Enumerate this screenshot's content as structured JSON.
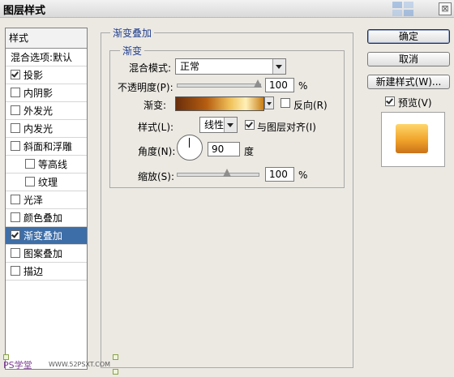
{
  "window": {
    "title": "图层样式",
    "close_label": "⊠"
  },
  "left_panel": {
    "header": "样式",
    "items": [
      {
        "label": "混合选项:默认",
        "checkbox": false,
        "checked": false,
        "selected": false,
        "sub": false
      },
      {
        "label": "投影",
        "checkbox": true,
        "checked": true,
        "selected": false,
        "sub": false
      },
      {
        "label": "内阴影",
        "checkbox": true,
        "checked": false,
        "selected": false,
        "sub": false
      },
      {
        "label": "外发光",
        "checkbox": true,
        "checked": false,
        "selected": false,
        "sub": false
      },
      {
        "label": "内发光",
        "checkbox": true,
        "checked": false,
        "selected": false,
        "sub": false
      },
      {
        "label": "斜面和浮雕",
        "checkbox": true,
        "checked": false,
        "selected": false,
        "sub": false
      },
      {
        "label": "等高线",
        "checkbox": true,
        "checked": false,
        "selected": false,
        "sub": true
      },
      {
        "label": "纹理",
        "checkbox": true,
        "checked": false,
        "selected": false,
        "sub": true
      },
      {
        "label": "光泽",
        "checkbox": true,
        "checked": false,
        "selected": false,
        "sub": false
      },
      {
        "label": "颜色叠加",
        "checkbox": true,
        "checked": false,
        "selected": false,
        "sub": false
      },
      {
        "label": "渐变叠加",
        "checkbox": true,
        "checked": true,
        "selected": true,
        "sub": false
      },
      {
        "label": "图案叠加",
        "checkbox": true,
        "checked": false,
        "selected": false,
        "sub": false
      },
      {
        "label": "描边",
        "checkbox": true,
        "checked": false,
        "selected": false,
        "sub": false
      }
    ]
  },
  "panel": {
    "group_title": "渐变叠加",
    "subgroup_title": "渐变",
    "blend_mode_label": "混合模式:",
    "blend_mode_value": "正常",
    "opacity_label": "不透明度(P):",
    "opacity_value": "100",
    "opacity_fraction": 1.0,
    "percent": "%",
    "gradient_label": "渐变:",
    "reverse_label": "反向(R)",
    "reverse_checked": false,
    "style_label": "样式(L):",
    "style_value": "线性",
    "align_label": "与图层对齐(I)",
    "align_checked": true,
    "angle_label": "角度(N):",
    "angle_value": "90",
    "degree_unit": "度",
    "scale_label": "缩放(S):",
    "scale_value": "100",
    "scale_fraction": 0.5
  },
  "buttons": {
    "ok": "确定",
    "cancel": "取消",
    "new_style": "新建样式(W)...",
    "preview_label": "预览(V)",
    "preview_checked": true
  },
  "watermark": {
    "text": "PS学堂",
    "url": "WWW.52PSXT.COM"
  },
  "colors": {
    "selection": "#3e6ea7",
    "group_title": "#1f3e8f",
    "gradient": [
      "#6a2e0b",
      "#b65d11",
      "#f0c25a",
      "#fff0b8",
      "#c97d16"
    ]
  }
}
